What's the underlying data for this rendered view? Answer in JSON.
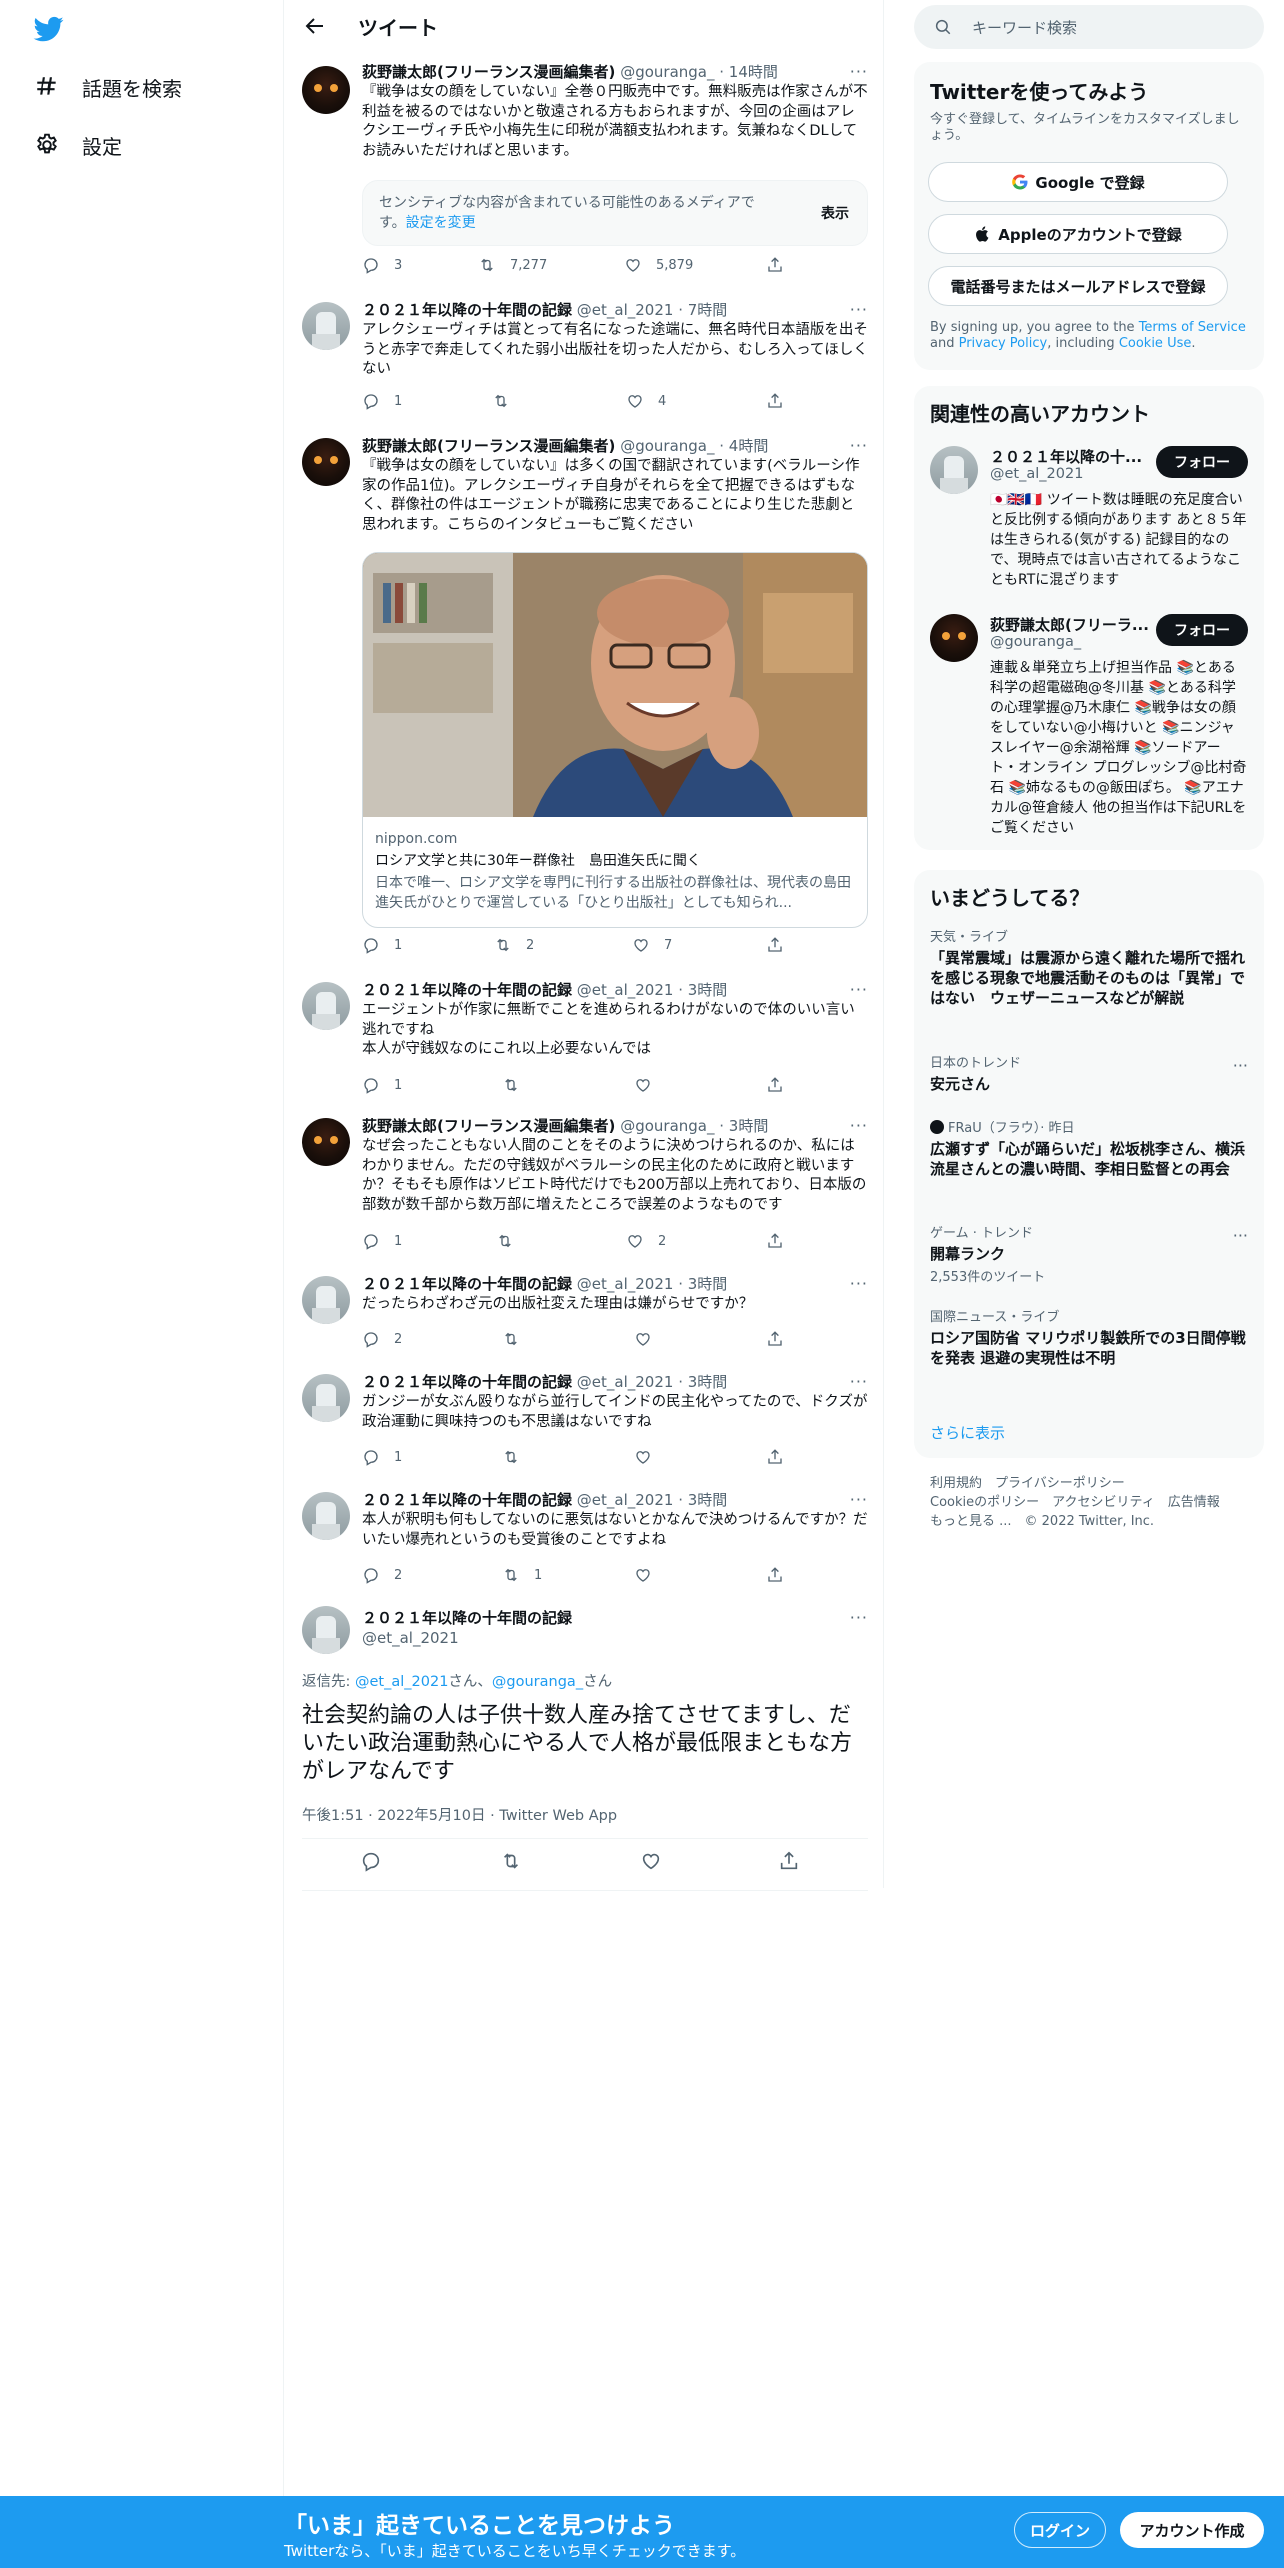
{
  "nav": {
    "explore_label": "話題を検索",
    "settings_label": "設定"
  },
  "header": {
    "title": "ツイート"
  },
  "tweets": [
    {
      "name": "荻野謙太郎(フリーランス漫画編集者)",
      "meta": "@gouranga_ · 14時間",
      "text": "『戦争は女の顔をしていない』全巻０円販売中です。無料販売は作家さんが不利益を被るのではないかと敬遠される方もおられますが、今回の企画はアレクシエーヴィチ氏や小梅先生に印税が満額支払われます。気兼ねなくDLしてお読みいただければと思います。",
      "sensitive_text": "センシティブな内容が含まれている可能性のあるメディアです。",
      "sensitive_link": "設定を変更",
      "sensitive_button": "表示",
      "replies": "3",
      "retweets": "7,277",
      "likes": "5,879"
    },
    {
      "name": "２０２１年以降の十年間の記録",
      "meta": "@et_al_2021 · 7時間",
      "text": "アレクシェーヴィチは賞とって有名になった途端に、無名時代日本語版を出そうと赤字で奔走してくれた弱小出版社を切った人だから、むしろ入ってほしくない",
      "replies": "1",
      "retweets": "",
      "likes": "4"
    },
    {
      "name": "荻野謙太郎(フリーランス漫画編集者)",
      "meta": "@gouranga_ · 4時間",
      "text": "『戦争は女の顔をしていない』は多くの国で翻訳されています(ベラルーシ作家の作品1位)。アレクシエーヴィチ自身がそれらを全て把握できるはずもなく、群像社の件はエージェントが職務に忠実であることにより生じた悲劇と思われます。こちらのインタビューもご覧ください",
      "card_domain": "nippon.com",
      "card_title": "ロシア文学と共に30年ー群像社　島田進矢氏に聞く",
      "card_desc": "日本で唯一、ロシア文学を専門に刊行する出版社の群像社は、現代表の島田進矢氏がひとりで運営している「ひとり出版社」としても知られ...",
      "replies": "1",
      "retweets": "2",
      "likes": "7"
    },
    {
      "name": "２０２１年以降の十年間の記録",
      "meta": "@et_al_2021 · 3時間",
      "text": "エージェントが作家に無断でことを進められるわけがないので体のいい言い逃れですね\n本人が守銭奴なのにこれ以上必要ないんでは",
      "replies": "1",
      "retweets": "",
      "likes": ""
    },
    {
      "name": "荻野謙太郎(フリーランス漫画編集者)",
      "meta": "@gouranga_ · 3時間",
      "text": "なぜ会ったこともない人間のことをそのように決めつけられるのか、私にはわかりません。ただの守銭奴がベラルーシの民主化のために政府と戦いますか？そもそも原作はソビエト時代だけでも200万部以上売れており、日本版の部数が数千部から数万部に増えたところで誤差のようなものです",
      "replies": "1",
      "retweets": "",
      "likes": "2"
    },
    {
      "name": "２０２１年以降の十年間の記録",
      "meta": "@et_al_2021 · 3時間",
      "text": "だったらわざわざ元の出版社変えた理由は嫌がらせですか？",
      "replies": "2",
      "retweets": "",
      "likes": ""
    },
    {
      "name": "２０２１年以降の十年間の記録",
      "meta": "@et_al_2021 · 3時間",
      "text": "ガンジーが女ぶん殴りながら並行してインドの民主化やってたので、ドクズが政治運動に興味持つのも不思議はないですね",
      "replies": "1",
      "retweets": "",
      "likes": ""
    },
    {
      "name": "２０２１年以降の十年間の記録",
      "meta": "@et_al_2021 · 3時間",
      "text": "本人が釈明も何もしてないのに悪気はないとかなんで決めつけるんですか？だいたい爆売れというのも受賞後のことですよね",
      "replies": "2",
      "retweets": "1",
      "likes": ""
    }
  ],
  "focus": {
    "name": "２０２１年以降の十年間の記録",
    "handle": "@et_al_2021",
    "reply_prefix": "返信先: ",
    "reply_to_1": "@et_al_2021",
    "reply_sep": "さん、",
    "reply_to_2": "@gouranga_",
    "reply_suffix": "さん",
    "text": "社会契約論の人は子供十数人産み捨てさせてますし、だいたい政治運動熱心にやる人で人格が最低限まともな方がレアなんです",
    "time": "午後1:51 · 2022年5月10日 · Twitter Web App"
  },
  "search": {
    "placeholder": "キーワード検索"
  },
  "signup_panel": {
    "title": "Twitterを使ってみよう",
    "subtitle": "今すぐ登録して、タイムラインをカスタマイズしましょう。",
    "google": "Google で登録",
    "apple": "Appleのアカウントで登録",
    "phone": "電話番号またはメールアドレスで登録",
    "terms_prefix": "By signing up, you agree to the ",
    "terms_link": "Terms of Service",
    "terms_and": " and ",
    "privacy_link": "Privacy Policy",
    "terms_including": ", including ",
    "cookie_link": "Cookie Use",
    "terms_end": "."
  },
  "related": {
    "title": "関連性の高いアカウント",
    "follow_label": "フォロー",
    "accounts": [
      {
        "name": "２０２１年以降の十...",
        "handle": "@et_al_2021",
        "bio": "🇯🇵🇬🇧🇫🇷 ツイート数は睡眠の充足度合いと反比例する傾向があります あと８５年は生きられる(気がする) 記録目的なので、現時点では言い古されてるようなこともRTに混ざります"
      },
      {
        "name": "荻野謙太郎(フリーラ...",
        "handle": "@gouranga_",
        "bio": "連載＆単発立ち上げ担当作品 📚とある科学の超電磁砲@冬川基 📚とある科学の心理掌握@乃木康仁 📚戦争は女の顔をしていない@小梅けいと 📚ニンジャスレイヤー@余湖裕輝 📚ソードアート・オンライン プログレッシブ@比村奇石 📚姉なるもの@飯田ぽち。 📚アエナカル@笹倉綾人 他の担当作は下記URLをご覧ください"
      }
    ]
  },
  "trends": {
    "title": "いまどうしてる？",
    "items": [
      {
        "category": "天気・ライブ",
        "title": "「異常震域」は震源から遠く離れた場所で揺れを感じる現象で地震活動そのものは「異常」ではない　ウェザーニュースなどが解説",
        "count": ""
      },
      {
        "category": "日本のトレンド",
        "title": "安元さん",
        "count": ""
      },
      {
        "category": "FRaU（フラウ）· 昨日",
        "title": "広瀬すず「心が踊らいだ」松坂桃李さん、横浜流星さんとの濃い時間、李相日監督との再会",
        "count": ""
      },
      {
        "category": "ゲーム · トレンド",
        "title": "開幕ランク",
        "count": "2,553件のツイート"
      },
      {
        "category": "国際ニュース・ライブ",
        "title": "ロシア国防省 マリウポリ製鉄所での3日間停戦を発表 退避の実現性は不明",
        "count": ""
      }
    ],
    "show_more": "さらに表示"
  },
  "footer": {
    "line1": "利用規約　プライバシーポリシー",
    "line2": "Cookieのポリシー　アクセシビリティ　広告情報",
    "line3": "もっと見る ...　© 2022 Twitter, Inc."
  },
  "bottom_bar": {
    "title": "「いま」起きていることを見つけよう",
    "subtitle": "Twitterなら、「いま」起きていることをいち早くチェックできます。",
    "login": "ログイン",
    "signup": "アカウント作成"
  },
  "colors": {
    "accent": "#1d9bf0",
    "text": "#0f1419",
    "muted": "#536471"
  }
}
